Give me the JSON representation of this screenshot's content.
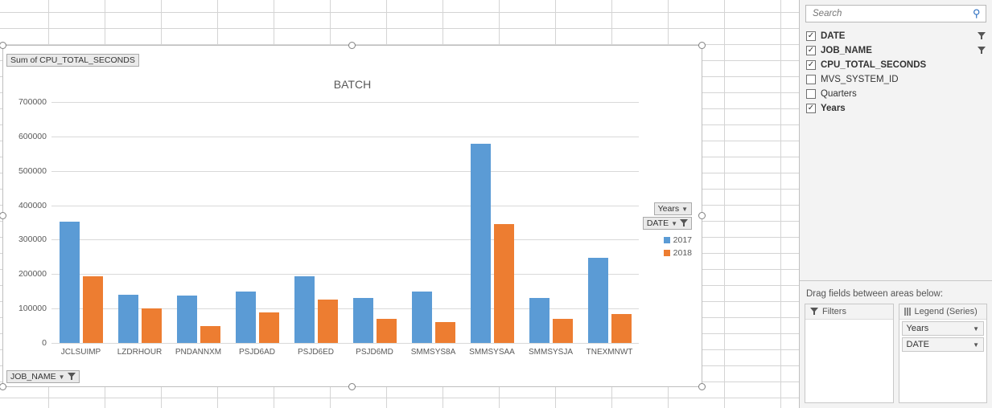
{
  "chart_data": {
    "type": "bar",
    "title": "BATCH",
    "value_field": "Sum of CPU_TOTAL_SECONDS",
    "categories": [
      "JCLSUIMP",
      "LZDRHOUR",
      "PNDANNXM",
      "PSJD6AD",
      "PSJD6ED",
      "PSJD6MD",
      "SMMSYS8A",
      "SMMSYSAA",
      "SMMSYSJA",
      "TNEXMNWT"
    ],
    "series": [
      {
        "name": "2017",
        "color": "#5B9BD5",
        "values": [
          352000,
          140000,
          137000,
          149000,
          193000,
          130000,
          150000,
          578000,
          130000,
          248000
        ]
      },
      {
        "name": "2018",
        "color": "#ED7D31",
        "values": [
          193000,
          100000,
          50000,
          88000,
          127000,
          71000,
          60000,
          345000,
          69000,
          83000
        ]
      }
    ],
    "ylim": [
      0,
      700000
    ],
    "ytick": 100000,
    "legend_controls": {
      "years_label": "Years",
      "date_label": "DATE"
    },
    "axis_field": "JOB_NAME"
  },
  "panel": {
    "search_placeholder": "Search",
    "fields": [
      {
        "label": "DATE",
        "checked": true,
        "bold": true,
        "filter": true
      },
      {
        "label": "JOB_NAME",
        "checked": true,
        "bold": true,
        "filter": true
      },
      {
        "label": "CPU_TOTAL_SECONDS",
        "checked": true,
        "bold": true,
        "filter": false
      },
      {
        "label": "MVS_SYSTEM_ID",
        "checked": false,
        "bold": false,
        "filter": false
      },
      {
        "label": "Quarters",
        "checked": false,
        "bold": false,
        "filter": false
      },
      {
        "label": "Years",
        "checked": true,
        "bold": true,
        "filter": false
      }
    ],
    "areas_label": "Drag fields between areas below:",
    "filters_header": "Filters",
    "legend_header": "Legend (Series)",
    "legend_items": [
      "Years",
      "DATE"
    ]
  }
}
